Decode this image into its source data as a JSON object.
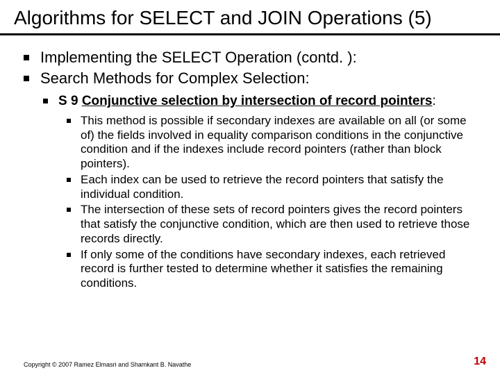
{
  "title": "Algorithms for SELECT and JOIN Operations (5)",
  "bullets": {
    "b1": "Implementing the SELECT Operation (contd. ):",
    "b2": "Search Methods for Complex Selection:",
    "s9_prefix": "S 9 ",
    "s9_underlined": "Conjunctive selection by intersection of record pointers",
    "s9_suffix": ":",
    "d1": "This method is possible if secondary indexes are available on all (or some of) the fields involved in equality comparison conditions in the conjunctive condition and if the indexes include record pointers (rather than block pointers).",
    "d2": "Each index can be used to retrieve the record pointers that satisfy the individual condition.",
    "d3": "The intersection of these sets of record pointers gives the record pointers that satisfy the conjunctive condition, which are then used to retrieve those records directly.",
    "d4": "If only some of the conditions have secondary indexes, each retrieved record is further tested to determine whether it satisfies the remaining conditions."
  },
  "footer": {
    "copyright": "Copyright © 2007 Ramez Elmasri and Shamkant B. Navathe",
    "page": "14"
  }
}
